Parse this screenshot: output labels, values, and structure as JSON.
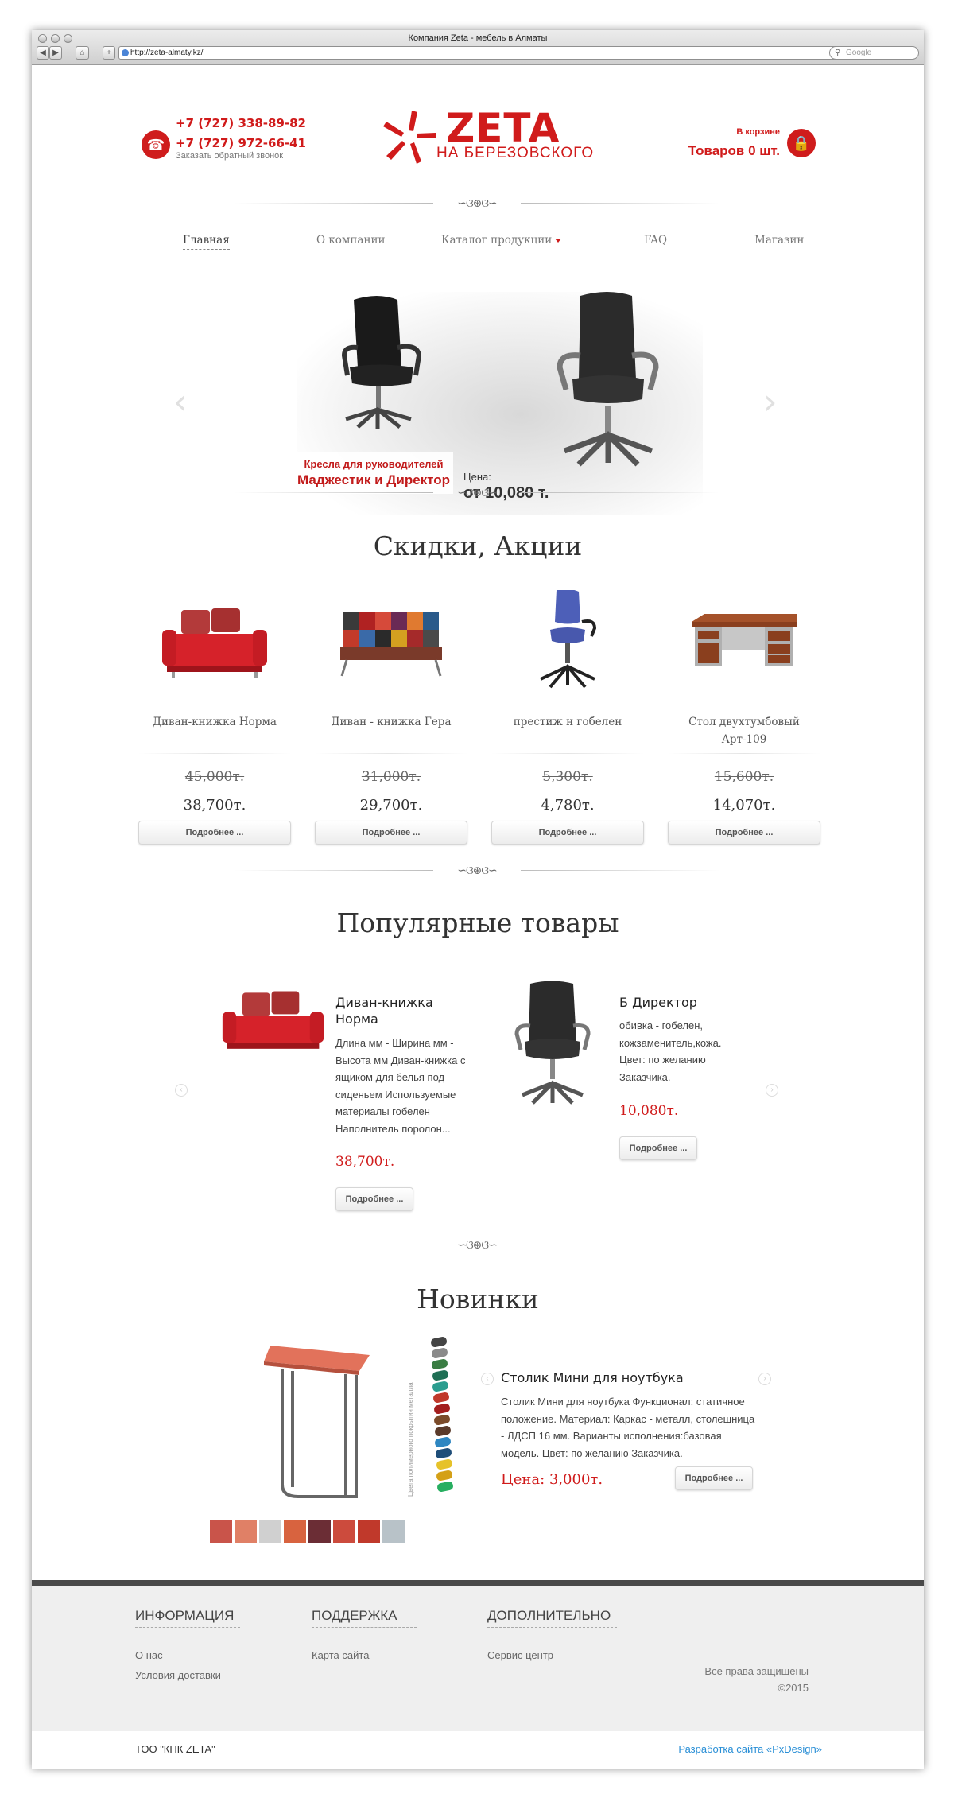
{
  "browser": {
    "window_title": "Компания Zeta - мебель в Алматы",
    "url": "http://zeta-almaty.kz/",
    "search_placeholder": "Google",
    "back": "◀",
    "forward": "▶",
    "home": "⌂",
    "add": "+",
    "reload": "↻"
  },
  "header": {
    "phone1": "+7 (727) 338-89-82",
    "phone2": "+7 (727) 972-66-41",
    "callback": "Заказать обратный звонок",
    "logo_name": "ZETA",
    "logo_sub": "НА БЕРЕЗОВСКОГО",
    "cart_label": "В корзине",
    "cart_count": "Товаров 0 шт."
  },
  "nav": [
    "Главная",
    "О компании",
    "Каталог продукции",
    "FAQ",
    "Магазин"
  ],
  "slider": {
    "caption_line1": "Кресла для руководителей",
    "caption_line2": "Маджестик и Директор",
    "price_label": "Цена:",
    "price": "от 10,080 т.",
    "prev": "‹",
    "next": "›"
  },
  "sales": {
    "title": "Скидки, Акции",
    "items": [
      {
        "name": "Диван-книжка Норма",
        "old_price": "45,000т.",
        "new_price": "38,700т.",
        "button": "Подробнее ..."
      },
      {
        "name": "Диван - книжка Гера",
        "old_price": "31,000т.",
        "new_price": "29,700т.",
        "button": "Подробнее ..."
      },
      {
        "name": "престиж н гобелен",
        "old_price": "5,300т.",
        "new_price": "4,780т.",
        "button": "Подробнее ..."
      },
      {
        "name": "Стол двухтумбовый Арт-109",
        "old_price": "15,600т.",
        "new_price": "14,070т.",
        "button": "Подробнее ..."
      }
    ]
  },
  "popular": {
    "title": "Популярные товары",
    "items": [
      {
        "name": "Диван-книжка Норма",
        "desc": "Длина мм - Ширина мм - Высота мм Диван-книжка с ящиком для белья под сиденьем Используемые материалы гобелен Наполнитель поролон...",
        "price": "38,700т.",
        "button": "Подробнее ..."
      },
      {
        "name": "Б Директор",
        "desc": "обивка - гобелен, кожзаменитель,кожа. Цвет: по желанию Заказчика.",
        "price": "10,080т.",
        "button": "Подробнее ..."
      }
    ]
  },
  "new_items": {
    "title": "Новинки",
    "name": "Столик Мини для ноутбука",
    "desc": "Столик Мини для ноутбука Функционал: статичное положение. Материал: Каркас - металл, столешница - ЛДСП 16 мм. Варианты исполнения:базовая модель. Цвет: по желанию Заказчика.",
    "price": "Цена: 3,000т.",
    "button": "Подробнее ...",
    "side_label": "Цвета полимерного покрытия металла",
    "swatch_colors": [
      "#c9544a",
      "#e08066",
      "#d0d0d0",
      "#d8633f",
      "#6b2d35",
      "#cc4b3d",
      "#c0392b",
      "#b8c2c8"
    ],
    "rod_colors": [
      "#444444",
      "#8a8a8a",
      "#3a7d44",
      "#1f6f55",
      "#2a9d8f",
      "#c0392b",
      "#a31d1d",
      "#7b4b2a",
      "#5a3a2a",
      "#2e86c1",
      "#1f4e79",
      "#e6c229",
      "#d4a017",
      "#27ae60"
    ]
  },
  "footer": {
    "col1_title": "ИНФОРМАЦИЯ",
    "col1_links": [
      "О нас",
      "Условия доставки"
    ],
    "col2_title": "ПОДДЕРЖКА",
    "col2_links": [
      "Карта сайта"
    ],
    "col3_title": "ДОПОЛНИТЕЛЬНО",
    "col3_links": [
      "Сервис центр"
    ],
    "rights": "Все права защищены",
    "year": "©2015",
    "company": "ТОО \"КПК ZETA\"",
    "developer": "Разработка сайта «PxDesign»"
  },
  "colors": {
    "accent": "#d01b1b",
    "dev_link": "#2a8fd6"
  }
}
